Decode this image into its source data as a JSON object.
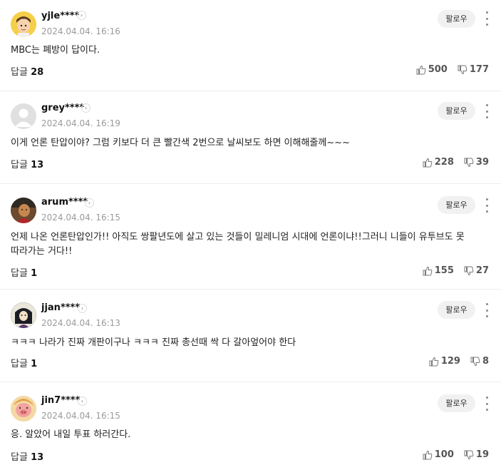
{
  "follow_label": "팔로우",
  "reply_label": "답글",
  "comments": [
    {
      "nick": "yjle****",
      "date": "2024.04.04. 16:16",
      "body": "MBC는 폐방이 답이다.",
      "replies": "28",
      "likes": "500",
      "dislikes": "177",
      "avatar": "cartoon-boy"
    },
    {
      "nick": "grey****",
      "date": "2024.04.04. 16:19",
      "body": "이게 언론 탄압이야? 그럼 키보다 더 큰 빨간색 2번으로 날씨보도 하면 이해해줄께~~~",
      "replies": "13",
      "likes": "228",
      "dislikes": "39",
      "avatar": "default"
    },
    {
      "nick": "arum****",
      "date": "2024.04.04. 16:15",
      "body": "언제 나온 언론탄압인가!! 아직도 쌍팔년도에 살고 있는 것들이 밀레니엄 시대에 언론이냐!!그러니 니들이 유투브도 못 따라가는 거다!!",
      "replies": "1",
      "likes": "155",
      "dislikes": "27",
      "avatar": "photo"
    },
    {
      "nick": "jjan****",
      "date": "2024.04.04. 16:13",
      "body": "ㅋㅋㅋ 나라가 진짜 개판이구나 ㅋㅋㅋ 진짜 총선때 싹 다 갈아엎어야 한다",
      "replies": "1",
      "likes": "129",
      "dislikes": "8",
      "avatar": "dark-character"
    },
    {
      "nick": "jin7****",
      "date": "2024.04.04. 16:15",
      "body": "응. 알았어 내일 투표 하러간다.",
      "replies": "13",
      "likes": "100",
      "dislikes": "19",
      "avatar": "pig-character"
    }
  ]
}
